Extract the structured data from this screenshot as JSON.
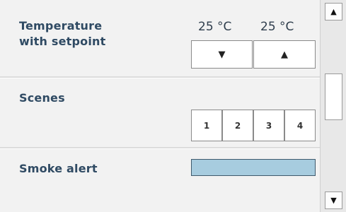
{
  "temperature": {
    "label": "Temperature\nwith setpoint",
    "current_value": "25 °C",
    "setpoint_value": "25 °C",
    "down_icon": "triangle-down",
    "up_icon": "triangle-up"
  },
  "scenes": {
    "label": "Scenes",
    "buttons": [
      "1",
      "2",
      "3",
      "4"
    ]
  },
  "smoke": {
    "label": "Smoke alert",
    "indicator_color": "#a7ccdf"
  },
  "scrollbar": {
    "up_icon": "triangle-up",
    "down_icon": "triangle-down"
  }
}
